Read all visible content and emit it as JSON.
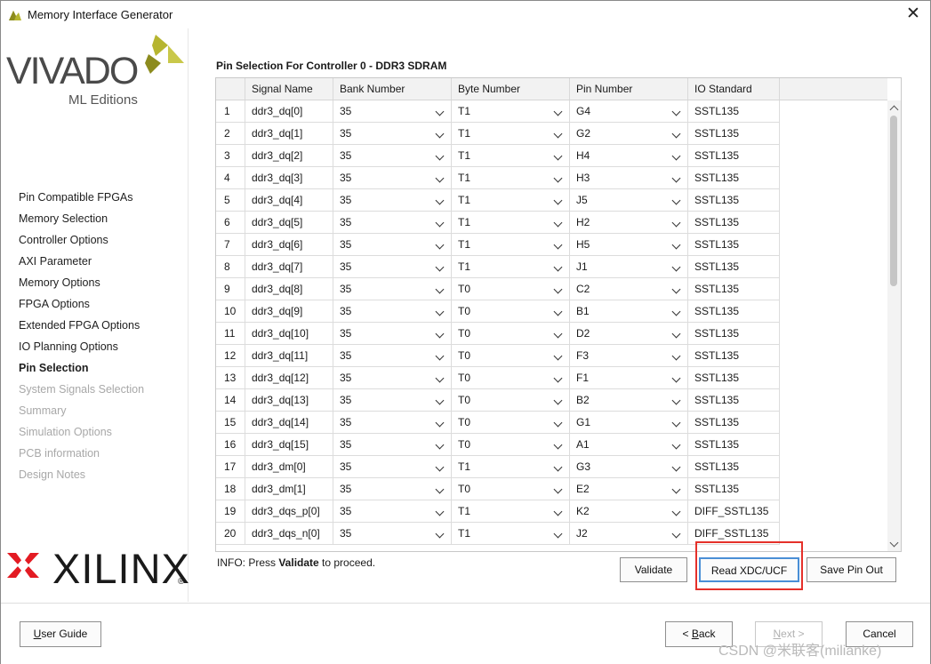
{
  "window": {
    "title": "Memory Interface Generator",
    "close_glyph": "✕"
  },
  "branding": {
    "vivado": "VIVADO",
    "edition": "ML Editions",
    "xilinx": "XILINX",
    "registered": "®"
  },
  "nav": [
    {
      "label": "Pin Compatible FPGAs",
      "state": "normal"
    },
    {
      "label": "Memory Selection",
      "state": "normal"
    },
    {
      "label": "Controller Options",
      "state": "normal"
    },
    {
      "label": "AXI Parameter",
      "state": "normal"
    },
    {
      "label": "Memory Options",
      "state": "normal"
    },
    {
      "label": "FPGA Options",
      "state": "normal"
    },
    {
      "label": "Extended FPGA Options",
      "state": "normal"
    },
    {
      "label": "IO Planning Options",
      "state": "normal"
    },
    {
      "label": "Pin Selection",
      "state": "active"
    },
    {
      "label": "System Signals Selection",
      "state": "disabled"
    },
    {
      "label": "Summary",
      "state": "disabled"
    },
    {
      "label": "Simulation Options",
      "state": "disabled"
    },
    {
      "label": "PCB information",
      "state": "disabled"
    },
    {
      "label": "Design Notes",
      "state": "disabled"
    }
  ],
  "main": {
    "section_title": "Pin Selection For Controller 0 - DDR3 SDRAM",
    "columns": [
      "",
      "Signal Name",
      "Bank Number",
      "Byte Number",
      "Pin Number",
      "IO Standard"
    ],
    "rows": [
      [
        "1",
        "ddr3_dq[0]",
        "35",
        "T1",
        "G4",
        "SSTL135"
      ],
      [
        "2",
        "ddr3_dq[1]",
        "35",
        "T1",
        "G2",
        "SSTL135"
      ],
      [
        "3",
        "ddr3_dq[2]",
        "35",
        "T1",
        "H4",
        "SSTL135"
      ],
      [
        "4",
        "ddr3_dq[3]",
        "35",
        "T1",
        "H3",
        "SSTL135"
      ],
      [
        "5",
        "ddr3_dq[4]",
        "35",
        "T1",
        "J5",
        "SSTL135"
      ],
      [
        "6",
        "ddr3_dq[5]",
        "35",
        "T1",
        "H2",
        "SSTL135"
      ],
      [
        "7",
        "ddr3_dq[6]",
        "35",
        "T1",
        "H5",
        "SSTL135"
      ],
      [
        "8",
        "ddr3_dq[7]",
        "35",
        "T1",
        "J1",
        "SSTL135"
      ],
      [
        "9",
        "ddr3_dq[8]",
        "35",
        "T0",
        "C2",
        "SSTL135"
      ],
      [
        "10",
        "ddr3_dq[9]",
        "35",
        "T0",
        "B1",
        "SSTL135"
      ],
      [
        "11",
        "ddr3_dq[10]",
        "35",
        "T0",
        "D2",
        "SSTL135"
      ],
      [
        "12",
        "ddr3_dq[11]",
        "35",
        "T0",
        "F3",
        "SSTL135"
      ],
      [
        "13",
        "ddr3_dq[12]",
        "35",
        "T0",
        "F1",
        "SSTL135"
      ],
      [
        "14",
        "ddr3_dq[13]",
        "35",
        "T0",
        "B2",
        "SSTL135"
      ],
      [
        "15",
        "ddr3_dq[14]",
        "35",
        "T0",
        "G1",
        "SSTL135"
      ],
      [
        "16",
        "ddr3_dq[15]",
        "35",
        "T0",
        "A1",
        "SSTL135"
      ],
      [
        "17",
        "ddr3_dm[0]",
        "35",
        "T1",
        "G3",
        "SSTL135"
      ],
      [
        "18",
        "ddr3_dm[1]",
        "35",
        "T0",
        "E2",
        "SSTL135"
      ],
      [
        "19",
        "ddr3_dqs_p[0]",
        "35",
        "T1",
        "K2",
        "DIFF_SSTL135"
      ],
      [
        "20",
        "ddr3_dqs_n[0]",
        "35",
        "T1",
        "J2",
        "DIFF_SSTL135"
      ]
    ],
    "info_prefix": "INFO: Press ",
    "info_bold": "Validate",
    "info_suffix": " to proceed.",
    "buttons": {
      "validate": "Validate",
      "read_xdc": "Read XDC/UCF",
      "save_pin": "Save Pin Out"
    }
  },
  "footer": {
    "user_guide_u": "U",
    "user_guide_rest": "ser Guide",
    "back_prefix": "< ",
    "back_u": "B",
    "back_rest": "ack",
    "next_u": "N",
    "next_rest": "ext >",
    "cancel": "Cancel"
  },
  "watermark": "CSDN @米联客(milianke)",
  "colors": {
    "accent": "#4a8fd6",
    "highlight": "#e5302a",
    "vivado_mark": "#b6b530",
    "xilinx_red": "#e31b23",
    "disabled": "#a8a8a8"
  },
  "icons": [
    "vivado-app-icon",
    "close-icon",
    "chevron-down-icon",
    "scroll-up-icon",
    "scroll-down-icon"
  ]
}
